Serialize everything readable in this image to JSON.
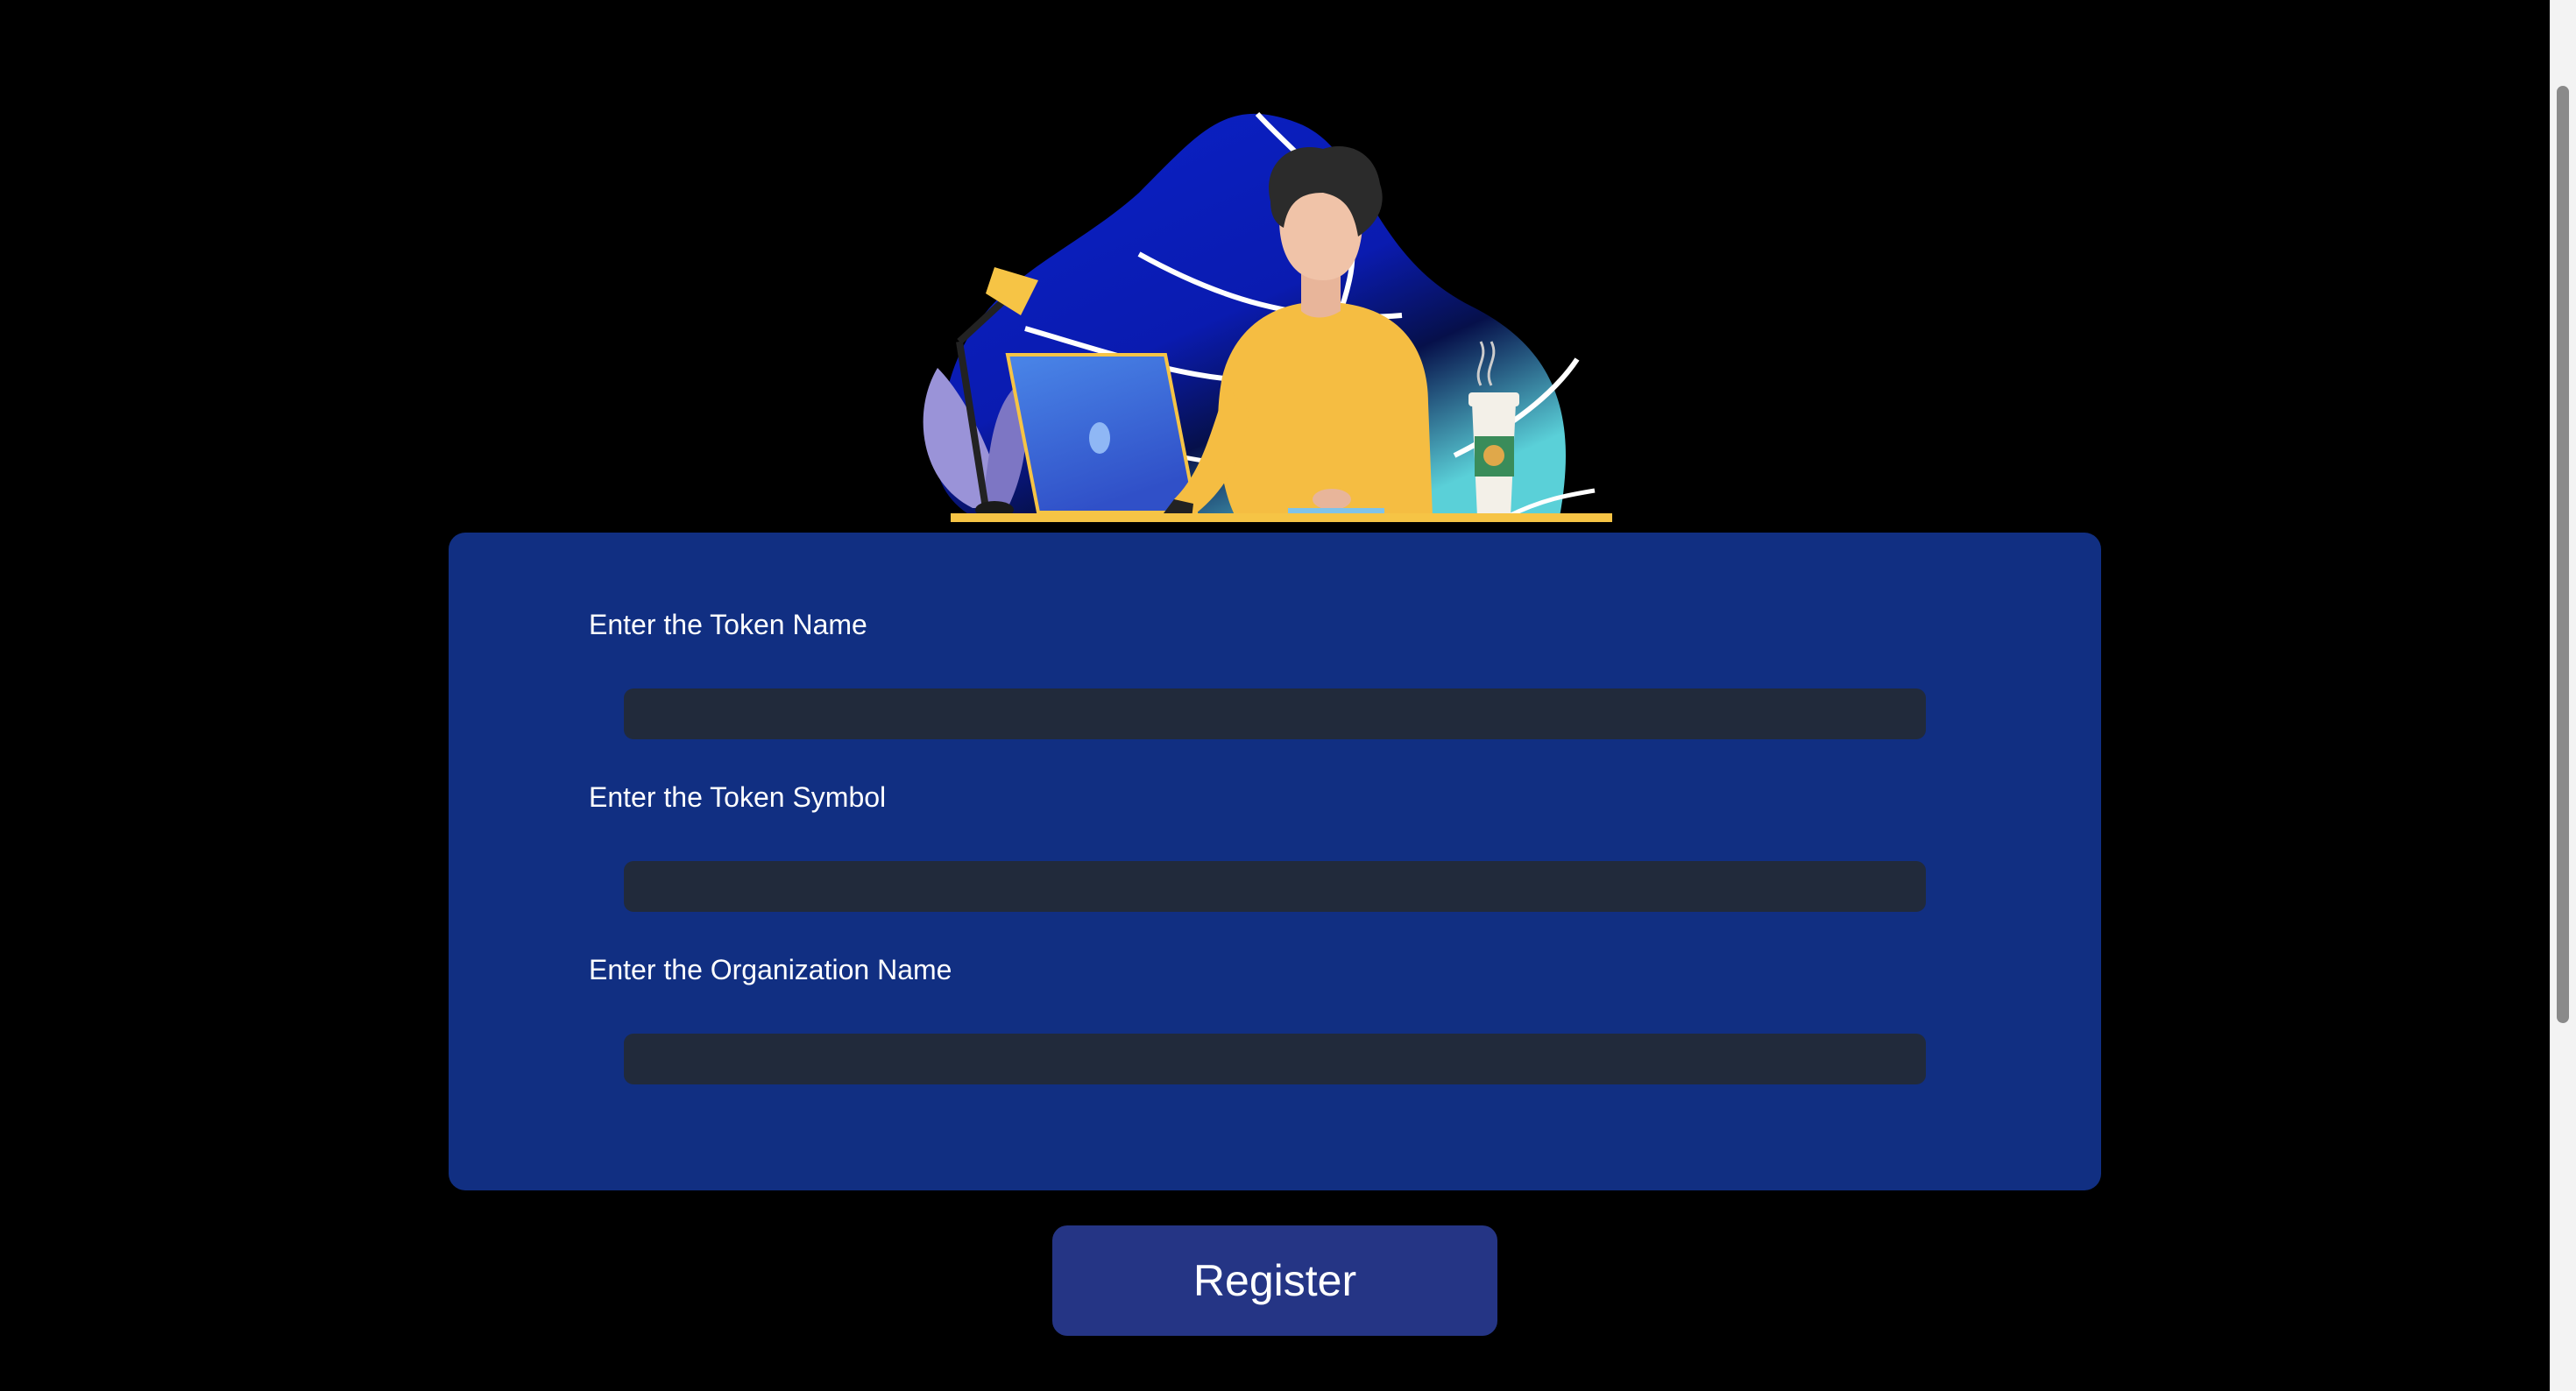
{
  "form": {
    "fields": [
      {
        "label": "Enter the Token Name",
        "value": "",
        "placeholder": ""
      },
      {
        "label": "Enter the Token Symbol",
        "value": "",
        "placeholder": ""
      },
      {
        "label": "Enter the Organization Name",
        "value": "",
        "placeholder": ""
      }
    ],
    "submit_label": "Register"
  },
  "illustration": {
    "icon": "person-working-at-laptop-illustration"
  },
  "colors": {
    "background": "#000000",
    "panel": "#112f82",
    "input": "#212a3b",
    "button": "#253585",
    "text": "#ffffff"
  }
}
